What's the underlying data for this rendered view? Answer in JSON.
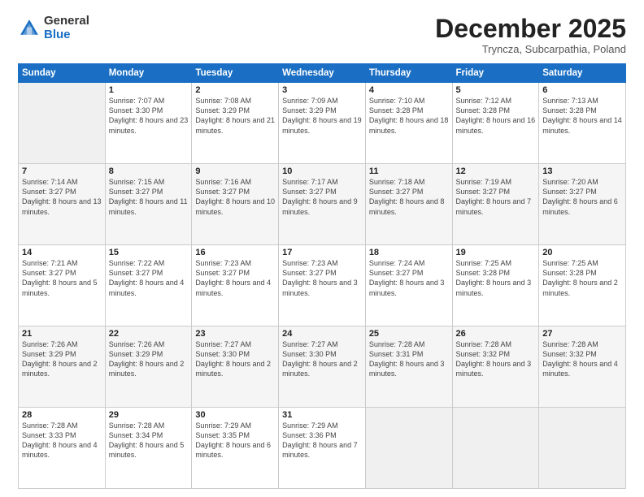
{
  "logo": {
    "general": "General",
    "blue": "Blue"
  },
  "header": {
    "month": "December 2025",
    "location": "Tryncza, Subcarpathia, Poland"
  },
  "weekdays": [
    "Sunday",
    "Monday",
    "Tuesday",
    "Wednesday",
    "Thursday",
    "Friday",
    "Saturday"
  ],
  "weeks": [
    [
      {
        "empty": true
      },
      {
        "day": 1,
        "sunrise": "Sunrise: 7:07 AM",
        "sunset": "Sunset: 3:30 PM",
        "daylight": "Daylight: 8 hours and 23 minutes."
      },
      {
        "day": 2,
        "sunrise": "Sunrise: 7:08 AM",
        "sunset": "Sunset: 3:29 PM",
        "daylight": "Daylight: 8 hours and 21 minutes."
      },
      {
        "day": 3,
        "sunrise": "Sunrise: 7:09 AM",
        "sunset": "Sunset: 3:29 PM",
        "daylight": "Daylight: 8 hours and 19 minutes."
      },
      {
        "day": 4,
        "sunrise": "Sunrise: 7:10 AM",
        "sunset": "Sunset: 3:28 PM",
        "daylight": "Daylight: 8 hours and 18 minutes."
      },
      {
        "day": 5,
        "sunrise": "Sunrise: 7:12 AM",
        "sunset": "Sunset: 3:28 PM",
        "daylight": "Daylight: 8 hours and 16 minutes."
      },
      {
        "day": 6,
        "sunrise": "Sunrise: 7:13 AM",
        "sunset": "Sunset: 3:28 PM",
        "daylight": "Daylight: 8 hours and 14 minutes."
      }
    ],
    [
      {
        "day": 7,
        "sunrise": "Sunrise: 7:14 AM",
        "sunset": "Sunset: 3:27 PM",
        "daylight": "Daylight: 8 hours and 13 minutes."
      },
      {
        "day": 8,
        "sunrise": "Sunrise: 7:15 AM",
        "sunset": "Sunset: 3:27 PM",
        "daylight": "Daylight: 8 hours and 11 minutes."
      },
      {
        "day": 9,
        "sunrise": "Sunrise: 7:16 AM",
        "sunset": "Sunset: 3:27 PM",
        "daylight": "Daylight: 8 hours and 10 minutes."
      },
      {
        "day": 10,
        "sunrise": "Sunrise: 7:17 AM",
        "sunset": "Sunset: 3:27 PM",
        "daylight": "Daylight: 8 hours and 9 minutes."
      },
      {
        "day": 11,
        "sunrise": "Sunrise: 7:18 AM",
        "sunset": "Sunset: 3:27 PM",
        "daylight": "Daylight: 8 hours and 8 minutes."
      },
      {
        "day": 12,
        "sunrise": "Sunrise: 7:19 AM",
        "sunset": "Sunset: 3:27 PM",
        "daylight": "Daylight: 8 hours and 7 minutes."
      },
      {
        "day": 13,
        "sunrise": "Sunrise: 7:20 AM",
        "sunset": "Sunset: 3:27 PM",
        "daylight": "Daylight: 8 hours and 6 minutes."
      }
    ],
    [
      {
        "day": 14,
        "sunrise": "Sunrise: 7:21 AM",
        "sunset": "Sunset: 3:27 PM",
        "daylight": "Daylight: 8 hours and 5 minutes."
      },
      {
        "day": 15,
        "sunrise": "Sunrise: 7:22 AM",
        "sunset": "Sunset: 3:27 PM",
        "daylight": "Daylight: 8 hours and 4 minutes."
      },
      {
        "day": 16,
        "sunrise": "Sunrise: 7:23 AM",
        "sunset": "Sunset: 3:27 PM",
        "daylight": "Daylight: 8 hours and 4 minutes."
      },
      {
        "day": 17,
        "sunrise": "Sunrise: 7:23 AM",
        "sunset": "Sunset: 3:27 PM",
        "daylight": "Daylight: 8 hours and 3 minutes."
      },
      {
        "day": 18,
        "sunrise": "Sunrise: 7:24 AM",
        "sunset": "Sunset: 3:27 PM",
        "daylight": "Daylight: 8 hours and 3 minutes."
      },
      {
        "day": 19,
        "sunrise": "Sunrise: 7:25 AM",
        "sunset": "Sunset: 3:28 PM",
        "daylight": "Daylight: 8 hours and 3 minutes."
      },
      {
        "day": 20,
        "sunrise": "Sunrise: 7:25 AM",
        "sunset": "Sunset: 3:28 PM",
        "daylight": "Daylight: 8 hours and 2 minutes."
      }
    ],
    [
      {
        "day": 21,
        "sunrise": "Sunrise: 7:26 AM",
        "sunset": "Sunset: 3:29 PM",
        "daylight": "Daylight: 8 hours and 2 minutes."
      },
      {
        "day": 22,
        "sunrise": "Sunrise: 7:26 AM",
        "sunset": "Sunset: 3:29 PM",
        "daylight": "Daylight: 8 hours and 2 minutes."
      },
      {
        "day": 23,
        "sunrise": "Sunrise: 7:27 AM",
        "sunset": "Sunset: 3:30 PM",
        "daylight": "Daylight: 8 hours and 2 minutes."
      },
      {
        "day": 24,
        "sunrise": "Sunrise: 7:27 AM",
        "sunset": "Sunset: 3:30 PM",
        "daylight": "Daylight: 8 hours and 2 minutes."
      },
      {
        "day": 25,
        "sunrise": "Sunrise: 7:28 AM",
        "sunset": "Sunset: 3:31 PM",
        "daylight": "Daylight: 8 hours and 3 minutes."
      },
      {
        "day": 26,
        "sunrise": "Sunrise: 7:28 AM",
        "sunset": "Sunset: 3:32 PM",
        "daylight": "Daylight: 8 hours and 3 minutes."
      },
      {
        "day": 27,
        "sunrise": "Sunrise: 7:28 AM",
        "sunset": "Sunset: 3:32 PM",
        "daylight": "Daylight: 8 hours and 4 minutes."
      }
    ],
    [
      {
        "day": 28,
        "sunrise": "Sunrise: 7:28 AM",
        "sunset": "Sunset: 3:33 PM",
        "daylight": "Daylight: 8 hours and 4 minutes."
      },
      {
        "day": 29,
        "sunrise": "Sunrise: 7:28 AM",
        "sunset": "Sunset: 3:34 PM",
        "daylight": "Daylight: 8 hours and 5 minutes."
      },
      {
        "day": 30,
        "sunrise": "Sunrise: 7:29 AM",
        "sunset": "Sunset: 3:35 PM",
        "daylight": "Daylight: 8 hours and 6 minutes."
      },
      {
        "day": 31,
        "sunrise": "Sunrise: 7:29 AM",
        "sunset": "Sunset: 3:36 PM",
        "daylight": "Daylight: 8 hours and 7 minutes."
      },
      {
        "empty": true
      },
      {
        "empty": true
      },
      {
        "empty": true
      }
    ]
  ]
}
